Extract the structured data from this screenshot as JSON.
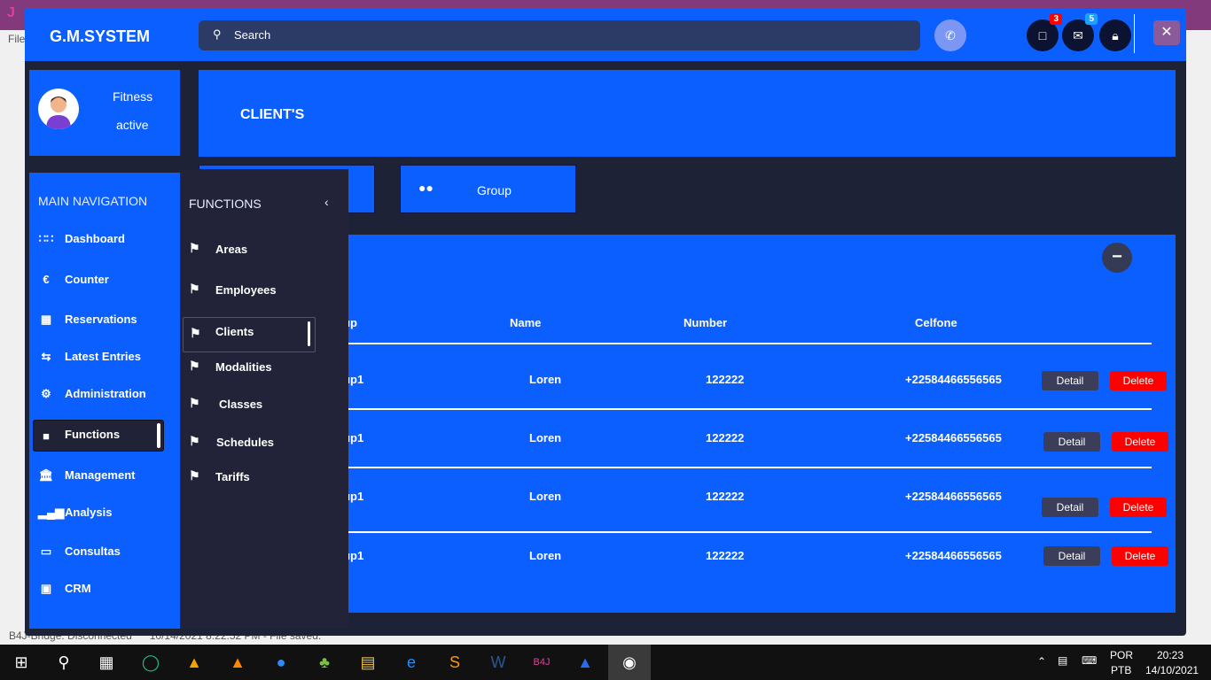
{
  "background": {
    "ide_menu_file": "File",
    "status_text": "B4J-Bridge: Disconnected      10/14/2021 8:22:52 PM - File saved."
  },
  "header": {
    "brand": "G.M.SYSTEM",
    "search_placeholder": "Search",
    "badges": {
      "devices": "3",
      "messages": "5"
    },
    "colors": {
      "primary": "#0a5ffe",
      "dark": "#1e2236",
      "badge_red": "#ff0000",
      "badge_blue": "#1ea0ff"
    }
  },
  "profile": {
    "line1": "Fitness",
    "line2": "active"
  },
  "content": {
    "title": "CLIENT'S",
    "tab_buttons": [
      {
        "label": ""
      },
      {
        "label": "Group",
        "icon": "users-icon"
      }
    ]
  },
  "table": {
    "columns": [
      "Group",
      "Name",
      "Number",
      "Celfone"
    ],
    "rows": [
      {
        "group": "Group1",
        "name": "Loren",
        "number": "122222",
        "celfone": "+22584466556565"
      },
      {
        "group": "Group1",
        "name": "Loren",
        "number": "122222",
        "celfone": "+22584466556565"
      },
      {
        "group": "Group1",
        "name": "Loren",
        "number": "122222",
        "celfone": "+22584466556565"
      },
      {
        "group": "Group1",
        "name": "Loren",
        "number": "122222",
        "celfone": "+22584466556565"
      }
    ],
    "detail_label": "Detail",
    "delete_label": "Delete"
  },
  "sidebar": {
    "heading": "MAIN NAVIGATION",
    "items": [
      {
        "label": "Dashboard",
        "icon": "grid-icon"
      },
      {
        "label": "Counter",
        "icon": "euro-icon"
      },
      {
        "label": "Reservations",
        "icon": "calendar-icon"
      },
      {
        "label": "Latest Entries",
        "icon": "exchange-icon"
      },
      {
        "label": "Administration",
        "icon": "cogs-icon"
      },
      {
        "label": "Functions",
        "icon": "folder-icon",
        "active": true
      },
      {
        "label": "Management",
        "icon": "bank-icon"
      },
      {
        "label": "Analysis",
        "icon": "signal-icon"
      },
      {
        "label": "Consultas",
        "icon": "book-icon"
      },
      {
        "label": "CRM",
        "icon": "briefcase-icon"
      }
    ]
  },
  "flyout": {
    "heading": "FUNCTIONS",
    "items": [
      {
        "label": "Areas"
      },
      {
        "label": "Employees"
      },
      {
        "label": "Clients",
        "active": true
      },
      {
        "label": "Modalities"
      },
      {
        "label": "Classes"
      },
      {
        "label": "Schedules"
      },
      {
        "label": "Tariffs"
      }
    ]
  },
  "taskbar": {
    "lang1": "POR",
    "lang2": "PTB",
    "time": "20:23",
    "date": "14/10/2021"
  }
}
